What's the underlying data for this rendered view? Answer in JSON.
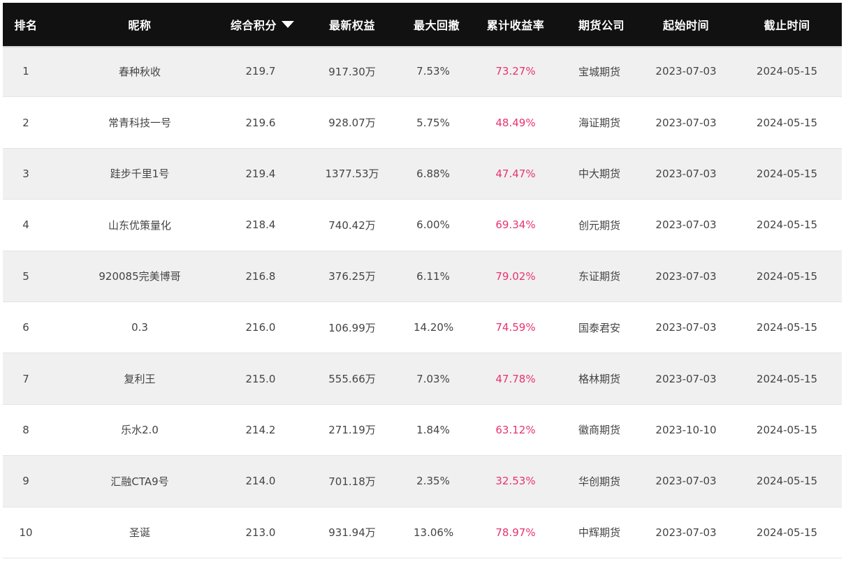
{
  "columns": {
    "rank": "排名",
    "name": "昵称",
    "score": "综合积分",
    "equity": "最新权益",
    "drawdown": "最大回撤",
    "return": "累计收益率",
    "broker": "期货公司",
    "start": "起始时间",
    "end": "截止时间"
  },
  "sort_icon": "triangle-down-icon",
  "colors": {
    "header_bg": "#111111",
    "return_color": "#e8336d",
    "odd_row_bg": "#f0f0f0"
  },
  "rows": [
    {
      "rank": "1",
      "name": "春种秋收",
      "score": "219.7",
      "equity": "917.30万",
      "drawdown": "7.53%",
      "return": "73.27%",
      "broker": "宝城期货",
      "start": "2023-07-03",
      "end": "2024-05-15"
    },
    {
      "rank": "2",
      "name": "常青科技一号",
      "score": "219.6",
      "equity": "928.07万",
      "drawdown": "5.75%",
      "return": "48.49%",
      "broker": "海证期货",
      "start": "2023-07-03",
      "end": "2024-05-15"
    },
    {
      "rank": "3",
      "name": "跬步千里1号",
      "score": "219.4",
      "equity": "1377.53万",
      "drawdown": "6.88%",
      "return": "47.47%",
      "broker": "中大期货",
      "start": "2023-07-03",
      "end": "2024-05-15"
    },
    {
      "rank": "4",
      "name": "山东优策量化",
      "score": "218.4",
      "equity": "740.42万",
      "drawdown": "6.00%",
      "return": "69.34%",
      "broker": "创元期货",
      "start": "2023-07-03",
      "end": "2024-05-15"
    },
    {
      "rank": "5",
      "name": "920085完美博哥",
      "score": "216.8",
      "equity": "376.25万",
      "drawdown": "6.11%",
      "return": "79.02%",
      "broker": "东证期货",
      "start": "2023-07-03",
      "end": "2024-05-15"
    },
    {
      "rank": "6",
      "name": "0.3",
      "score": "216.0",
      "equity": "106.99万",
      "drawdown": "14.20%",
      "return": "74.59%",
      "broker": "国泰君安",
      "start": "2023-07-03",
      "end": "2024-05-15"
    },
    {
      "rank": "7",
      "name": "复利王",
      "score": "215.0",
      "equity": "555.66万",
      "drawdown": "7.03%",
      "return": "47.78%",
      "broker": "格林期货",
      "start": "2023-07-03",
      "end": "2024-05-15"
    },
    {
      "rank": "8",
      "name": "乐水2.0",
      "score": "214.2",
      "equity": "271.19万",
      "drawdown": "1.84%",
      "return": "63.12%",
      "broker": "徽商期货",
      "start": "2023-10-10",
      "end": "2024-05-15"
    },
    {
      "rank": "9",
      "name": "汇融CTA9号",
      "score": "214.0",
      "equity": "701.18万",
      "drawdown": "2.35%",
      "return": "32.53%",
      "broker": "华创期货",
      "start": "2023-07-03",
      "end": "2024-05-15"
    },
    {
      "rank": "10",
      "name": "圣诞",
      "score": "213.0",
      "equity": "931.94万",
      "drawdown": "13.06%",
      "return": "78.97%",
      "broker": "中辉期货",
      "start": "2023-07-03",
      "end": "2024-05-15"
    }
  ]
}
